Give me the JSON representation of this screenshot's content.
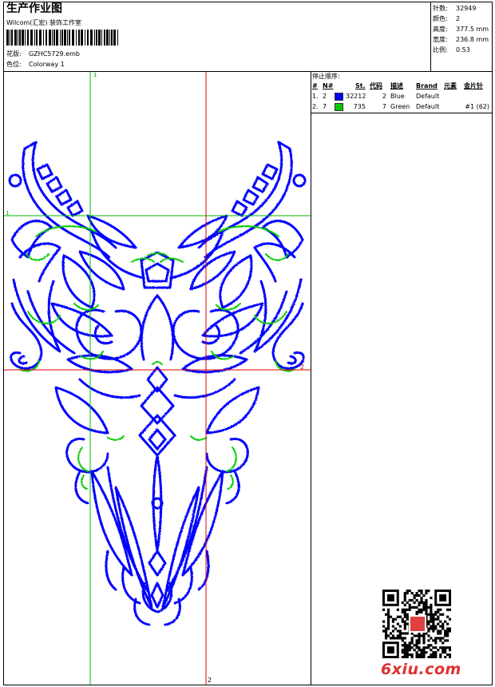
{
  "header": {
    "title": "生产作业图",
    "company": "Wilcom(汇宏) 装饰工作室",
    "design_label": "花版:",
    "design_value": "GZHC5729.emb",
    "colorway_label": "色位:",
    "colorway_value": "Colorway 1"
  },
  "stats": {
    "stitches_label": "针数:",
    "stitches_value": "32949",
    "colors_label": "颜色:",
    "colors_value": "2",
    "height_label": "高度:",
    "height_value": "377.5 mm",
    "width_label": "宽度:",
    "width_value": "236.8 mm",
    "scale_label": "比例:",
    "scale_value": "0.53"
  },
  "stop_sequence": {
    "title": "停止顺序:",
    "columns": [
      "#",
      "N#",
      "St.",
      "代码",
      "描述",
      "Brand",
      "元素",
      "金片针"
    ],
    "rows": [
      {
        "index": "1.",
        "n": "2",
        "swatch": "#0000ff",
        "st": "32212",
        "code": "2",
        "desc": "Blue",
        "brand": "Default",
        "element": "",
        "sequin": ""
      },
      {
        "index": "2.",
        "n": "7",
        "swatch": "#00cc00",
        "st": "735",
        "code": "7",
        "desc": "Green",
        "brand": "Default",
        "element": "",
        "sequin": "#1 (62)"
      }
    ]
  },
  "guides": {
    "green_v_label": "1",
    "green_h_label": "1",
    "red_h_label": "2",
    "red_v_label": "2"
  },
  "watermark": {
    "site": "6xiu.com"
  },
  "colors": {
    "blue_thread": "#0000ff",
    "green_thread": "#00cc00",
    "guide_green": "#00bb00",
    "guide_red": "#dd0000",
    "watermark_red": "#e03030"
  }
}
